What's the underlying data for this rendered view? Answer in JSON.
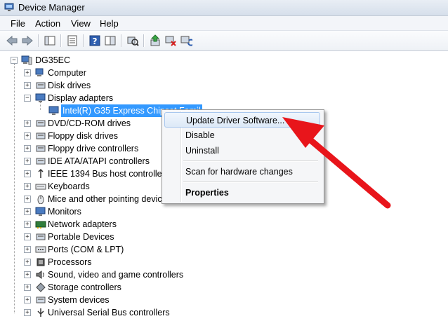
{
  "window": {
    "title": "Device Manager",
    "icon": "device-manager-icon"
  },
  "menu": {
    "items": [
      "File",
      "Action",
      "View",
      "Help"
    ]
  },
  "toolbar": {
    "buttons": [
      "back-arrow-icon",
      "forward-arrow-icon",
      "console-tree-icon",
      "properties-icon",
      "help-icon",
      "show-hide-icon",
      "scan-hardware-icon",
      "update-driver-icon",
      "disable-device-icon",
      "uninstall-device-icon"
    ]
  },
  "tree": {
    "root": "DG35EC",
    "items": [
      {
        "label": "Computer",
        "icon": "computer-icon"
      },
      {
        "label": "Disk drives",
        "icon": "disk-drive-icon"
      },
      {
        "label": "Display adapters",
        "icon": "display-adapter-icon",
        "expanded": true
      },
      {
        "label": "Intel(R)  G35 Express Chipset Famil",
        "icon": "monitor-icon",
        "selected": true
      },
      {
        "label": "DVD/CD-ROM drives",
        "icon": "dvd-drive-icon"
      },
      {
        "label": "Floppy disk drives",
        "icon": "floppy-disk-icon"
      },
      {
        "label": "Floppy drive controllers",
        "icon": "floppy-controller-icon"
      },
      {
        "label": "IDE ATA/ATAPI controllers",
        "icon": "ide-controller-icon"
      },
      {
        "label": "IEEE 1394 Bus host controllers",
        "icon": "ieee1394-icon"
      },
      {
        "label": "Keyboards",
        "icon": "keyboard-icon"
      },
      {
        "label": "Mice and other pointing devic",
        "icon": "mouse-icon"
      },
      {
        "label": "Monitors",
        "icon": "monitor-icon"
      },
      {
        "label": "Network adapters",
        "icon": "network-adapter-icon"
      },
      {
        "label": "Portable Devices",
        "icon": "portable-device-icon"
      },
      {
        "label": "Ports (COM & LPT)",
        "icon": "port-icon"
      },
      {
        "label": "Processors",
        "icon": "processor-icon"
      },
      {
        "label": "Sound, video and game controllers",
        "icon": "sound-icon"
      },
      {
        "label": "Storage controllers",
        "icon": "storage-controller-icon"
      },
      {
        "label": "System devices",
        "icon": "system-device-icon"
      },
      {
        "label": "Universal Serial Bus controllers",
        "icon": "usb-icon"
      }
    ]
  },
  "context_menu": {
    "update_driver": "Update Driver Software...",
    "disable": "Disable",
    "uninstall": "Uninstall",
    "scan": "Scan for hardware changes",
    "properties": "Properties"
  },
  "annotation": {
    "arrow_color": "#e8151b"
  },
  "colors": {
    "selection": "#3399ff",
    "menu_highlight_border": "#a8c7ee"
  }
}
